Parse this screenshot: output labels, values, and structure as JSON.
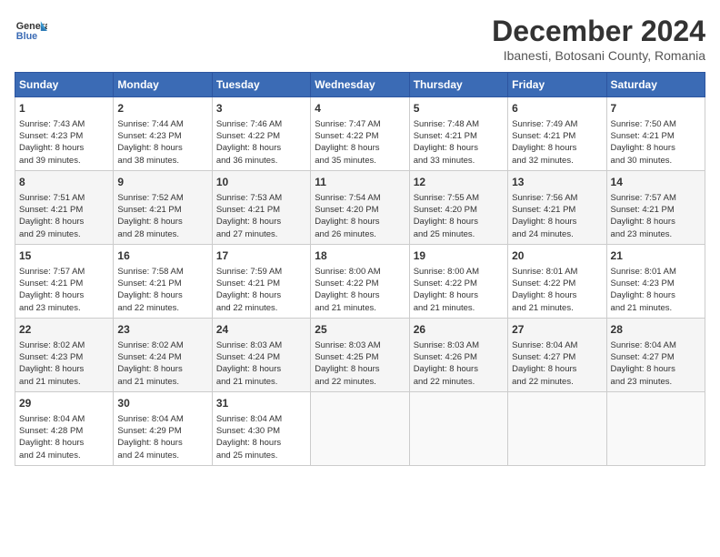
{
  "header": {
    "logo_line1": "General",
    "logo_line2": "Blue",
    "title": "December 2024",
    "subtitle": "Ibanesti, Botosani County, Romania"
  },
  "weekdays": [
    "Sunday",
    "Monday",
    "Tuesday",
    "Wednesday",
    "Thursday",
    "Friday",
    "Saturday"
  ],
  "weeks": [
    [
      {
        "day": "1",
        "lines": [
          "Sunrise: 7:43 AM",
          "Sunset: 4:23 PM",
          "Daylight: 8 hours",
          "and 39 minutes."
        ]
      },
      {
        "day": "2",
        "lines": [
          "Sunrise: 7:44 AM",
          "Sunset: 4:23 PM",
          "Daylight: 8 hours",
          "and 38 minutes."
        ]
      },
      {
        "day": "3",
        "lines": [
          "Sunrise: 7:46 AM",
          "Sunset: 4:22 PM",
          "Daylight: 8 hours",
          "and 36 minutes."
        ]
      },
      {
        "day": "4",
        "lines": [
          "Sunrise: 7:47 AM",
          "Sunset: 4:22 PM",
          "Daylight: 8 hours",
          "and 35 minutes."
        ]
      },
      {
        "day": "5",
        "lines": [
          "Sunrise: 7:48 AM",
          "Sunset: 4:21 PM",
          "Daylight: 8 hours",
          "and 33 minutes."
        ]
      },
      {
        "day": "6",
        "lines": [
          "Sunrise: 7:49 AM",
          "Sunset: 4:21 PM",
          "Daylight: 8 hours",
          "and 32 minutes."
        ]
      },
      {
        "day": "7",
        "lines": [
          "Sunrise: 7:50 AM",
          "Sunset: 4:21 PM",
          "Daylight: 8 hours",
          "and 30 minutes."
        ]
      }
    ],
    [
      {
        "day": "8",
        "lines": [
          "Sunrise: 7:51 AM",
          "Sunset: 4:21 PM",
          "Daylight: 8 hours",
          "and 29 minutes."
        ]
      },
      {
        "day": "9",
        "lines": [
          "Sunrise: 7:52 AM",
          "Sunset: 4:21 PM",
          "Daylight: 8 hours",
          "and 28 minutes."
        ]
      },
      {
        "day": "10",
        "lines": [
          "Sunrise: 7:53 AM",
          "Sunset: 4:21 PM",
          "Daylight: 8 hours",
          "and 27 minutes."
        ]
      },
      {
        "day": "11",
        "lines": [
          "Sunrise: 7:54 AM",
          "Sunset: 4:20 PM",
          "Daylight: 8 hours",
          "and 26 minutes."
        ]
      },
      {
        "day": "12",
        "lines": [
          "Sunrise: 7:55 AM",
          "Sunset: 4:20 PM",
          "Daylight: 8 hours",
          "and 25 minutes."
        ]
      },
      {
        "day": "13",
        "lines": [
          "Sunrise: 7:56 AM",
          "Sunset: 4:21 PM",
          "Daylight: 8 hours",
          "and 24 minutes."
        ]
      },
      {
        "day": "14",
        "lines": [
          "Sunrise: 7:57 AM",
          "Sunset: 4:21 PM",
          "Daylight: 8 hours",
          "and 23 minutes."
        ]
      }
    ],
    [
      {
        "day": "15",
        "lines": [
          "Sunrise: 7:57 AM",
          "Sunset: 4:21 PM",
          "Daylight: 8 hours",
          "and 23 minutes."
        ]
      },
      {
        "day": "16",
        "lines": [
          "Sunrise: 7:58 AM",
          "Sunset: 4:21 PM",
          "Daylight: 8 hours",
          "and 22 minutes."
        ]
      },
      {
        "day": "17",
        "lines": [
          "Sunrise: 7:59 AM",
          "Sunset: 4:21 PM",
          "Daylight: 8 hours",
          "and 22 minutes."
        ]
      },
      {
        "day": "18",
        "lines": [
          "Sunrise: 8:00 AM",
          "Sunset: 4:22 PM",
          "Daylight: 8 hours",
          "and 21 minutes."
        ]
      },
      {
        "day": "19",
        "lines": [
          "Sunrise: 8:00 AM",
          "Sunset: 4:22 PM",
          "Daylight: 8 hours",
          "and 21 minutes."
        ]
      },
      {
        "day": "20",
        "lines": [
          "Sunrise: 8:01 AM",
          "Sunset: 4:22 PM",
          "Daylight: 8 hours",
          "and 21 minutes."
        ]
      },
      {
        "day": "21",
        "lines": [
          "Sunrise: 8:01 AM",
          "Sunset: 4:23 PM",
          "Daylight: 8 hours",
          "and 21 minutes."
        ]
      }
    ],
    [
      {
        "day": "22",
        "lines": [
          "Sunrise: 8:02 AM",
          "Sunset: 4:23 PM",
          "Daylight: 8 hours",
          "and 21 minutes."
        ]
      },
      {
        "day": "23",
        "lines": [
          "Sunrise: 8:02 AM",
          "Sunset: 4:24 PM",
          "Daylight: 8 hours",
          "and 21 minutes."
        ]
      },
      {
        "day": "24",
        "lines": [
          "Sunrise: 8:03 AM",
          "Sunset: 4:24 PM",
          "Daylight: 8 hours",
          "and 21 minutes."
        ]
      },
      {
        "day": "25",
        "lines": [
          "Sunrise: 8:03 AM",
          "Sunset: 4:25 PM",
          "Daylight: 8 hours",
          "and 22 minutes."
        ]
      },
      {
        "day": "26",
        "lines": [
          "Sunrise: 8:03 AM",
          "Sunset: 4:26 PM",
          "Daylight: 8 hours",
          "and 22 minutes."
        ]
      },
      {
        "day": "27",
        "lines": [
          "Sunrise: 8:04 AM",
          "Sunset: 4:27 PM",
          "Daylight: 8 hours",
          "and 22 minutes."
        ]
      },
      {
        "day": "28",
        "lines": [
          "Sunrise: 8:04 AM",
          "Sunset: 4:27 PM",
          "Daylight: 8 hours",
          "and 23 minutes."
        ]
      }
    ],
    [
      {
        "day": "29",
        "lines": [
          "Sunrise: 8:04 AM",
          "Sunset: 4:28 PM",
          "Daylight: 8 hours",
          "and 24 minutes."
        ]
      },
      {
        "day": "30",
        "lines": [
          "Sunrise: 8:04 AM",
          "Sunset: 4:29 PM",
          "Daylight: 8 hours",
          "and 24 minutes."
        ]
      },
      {
        "day": "31",
        "lines": [
          "Sunrise: 8:04 AM",
          "Sunset: 4:30 PM",
          "Daylight: 8 hours",
          "and 25 minutes."
        ]
      },
      null,
      null,
      null,
      null
    ]
  ]
}
